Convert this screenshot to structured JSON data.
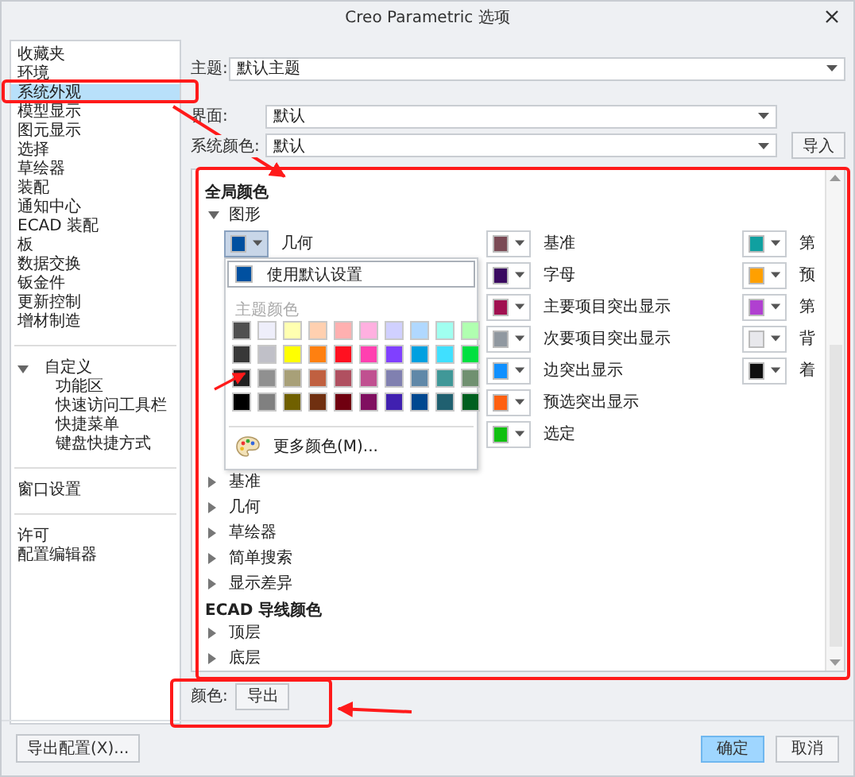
{
  "window": {
    "title": "Creo Parametric 选项"
  },
  "sidebar": {
    "groups": [
      {
        "items": [
          {
            "label": "收藏夹",
            "selected": false
          },
          {
            "label": "环境",
            "selected": false
          },
          {
            "label": "系统外观",
            "selected": true
          },
          {
            "label": "模型显示",
            "selected": false
          },
          {
            "label": "图元显示",
            "selected": false
          },
          {
            "label": "选择",
            "selected": false
          },
          {
            "label": "草绘器",
            "selected": false
          },
          {
            "label": "装配",
            "selected": false
          },
          {
            "label": "通知中心",
            "selected": false
          },
          {
            "label": "ECAD 装配",
            "selected": false
          },
          {
            "label": "板",
            "selected": false
          },
          {
            "label": "数据交换",
            "selected": false
          },
          {
            "label": "钣金件",
            "selected": false
          },
          {
            "label": "更新控制",
            "selected": false
          },
          {
            "label": "增材制造",
            "selected": false
          }
        ]
      },
      {
        "items": [
          {
            "label": "自定义",
            "selected": false,
            "expanded": true,
            "children": [
              {
                "label": "功能区",
                "selected": false
              },
              {
                "label": "快速访问工具栏",
                "selected": false
              },
              {
                "label": "快捷菜单",
                "selected": false
              },
              {
                "label": "键盘快捷方式",
                "selected": false
              }
            ]
          }
        ]
      },
      {
        "items": [
          {
            "label": "窗口设置",
            "selected": false
          }
        ]
      },
      {
        "items": [
          {
            "label": "许可",
            "selected": false
          },
          {
            "label": "配置编辑器",
            "selected": false
          }
        ]
      }
    ]
  },
  "theme": {
    "label": "主题:",
    "value": "默认主题"
  },
  "interface": {
    "label": "界面:",
    "value": "默认"
  },
  "system_colors": {
    "label": "系统颜色:",
    "value": "默认",
    "button": "导入"
  },
  "panel": {
    "sections": [
      {
        "heading": "全局颜色",
        "nodes": [
          {
            "label": "图形",
            "expanded": true,
            "columns": [
              [
                {
                  "label": "几何",
                  "color": "#0050a0",
                  "open": true
                }
              ],
              [
                {
                  "label": "基准",
                  "color": "#7a4a55",
                  "open": false
                },
                {
                  "label": "字母",
                  "color": "#3a0a60",
                  "open": false
                },
                {
                  "label": "主要项目突出显示",
                  "color": "#a01050",
                  "open": false
                },
                {
                  "label": "次要项目突出显示",
                  "color": "#9098a0",
                  "open": false
                },
                {
                  "label": "边突出显示",
                  "color": "#1090ff",
                  "open": false
                },
                {
                  "label": "预选突出显示",
                  "color": "#ff6010",
                  "open": false
                },
                {
                  "label": "选定",
                  "color": "#10c010",
                  "open": false
                }
              ],
              [
                {
                  "label": "第",
                  "color": "#10a0a0",
                  "open": false
                },
                {
                  "label": "预",
                  "color": "#ffa000",
                  "open": false
                },
                {
                  "label": "第",
                  "color": "#b040d0",
                  "open": false
                },
                {
                  "label": "背",
                  "color": "#e8e8ec",
                  "open": false
                },
                {
                  "label": "着",
                  "color": "#101010",
                  "open": false
                }
              ]
            ]
          },
          {
            "label": "基准",
            "expanded": false
          },
          {
            "label": "几何",
            "expanded": false
          },
          {
            "label": "草绘器",
            "expanded": false
          },
          {
            "label": "简单搜索",
            "expanded": false
          },
          {
            "label": "显示差异",
            "expanded": false
          }
        ]
      },
      {
        "heading": "ECAD 导线颜色",
        "nodes": [
          {
            "label": "顶层",
            "expanded": false
          },
          {
            "label": "底层",
            "expanded": false
          }
        ]
      }
    ]
  },
  "color_popup": {
    "default_item": {
      "label": "使用默认设置",
      "color": "#0050a0"
    },
    "section_title": "主题颜色",
    "more_label": "更多颜色(M)...",
    "colors": [
      {
        "color": "#505050"
      },
      {
        "color": "#eeeefa"
      },
      {
        "color": "#ffffb0"
      },
      {
        "color": "#ffd0b0"
      },
      {
        "color": "#ffb0b0"
      },
      {
        "color": "#ffb0e0"
      },
      {
        "color": "#d0d0ff"
      },
      {
        "color": "#b0d8ff"
      },
      {
        "color": "#a0fff0"
      },
      {
        "color": "#b0ffb0"
      },
      {
        "color": "#383838"
      },
      {
        "color": "#c0c0c8"
      },
      {
        "color": "#ffff00"
      },
      {
        "color": "#ff8010"
      },
      {
        "color": "#ff1020"
      },
      {
        "color": "#ff40b0"
      },
      {
        "color": "#8040ff"
      },
      {
        "color": "#00a0e0"
      },
      {
        "color": "#40e0ff"
      },
      {
        "color": "#00e040"
      },
      {
        "color": "#202020"
      },
      {
        "color": "#909090"
      },
      {
        "color": "#a8a078"
      },
      {
        "color": "#c06040"
      },
      {
        "color": "#b05060"
      },
      {
        "color": "#c05090"
      },
      {
        "color": "#8080b0"
      },
      {
        "color": "#6088a8"
      },
      {
        "color": "#409898"
      },
      {
        "color": "#709070"
      },
      {
        "color": "#000000"
      },
      {
        "color": "#808080"
      },
      {
        "color": "#706000"
      },
      {
        "color": "#703010"
      },
      {
        "color": "#700010"
      },
      {
        "color": "#801060"
      },
      {
        "color": "#4020b0"
      },
      {
        "color": "#004890"
      },
      {
        "color": "#206070"
      },
      {
        "color": "#006020"
      }
    ]
  },
  "colors_row": {
    "label": "颜色:",
    "button": "导出"
  },
  "footer": {
    "export_button": "导出配置(X)...",
    "ok_button": "确定",
    "cancel_button": "取消"
  }
}
